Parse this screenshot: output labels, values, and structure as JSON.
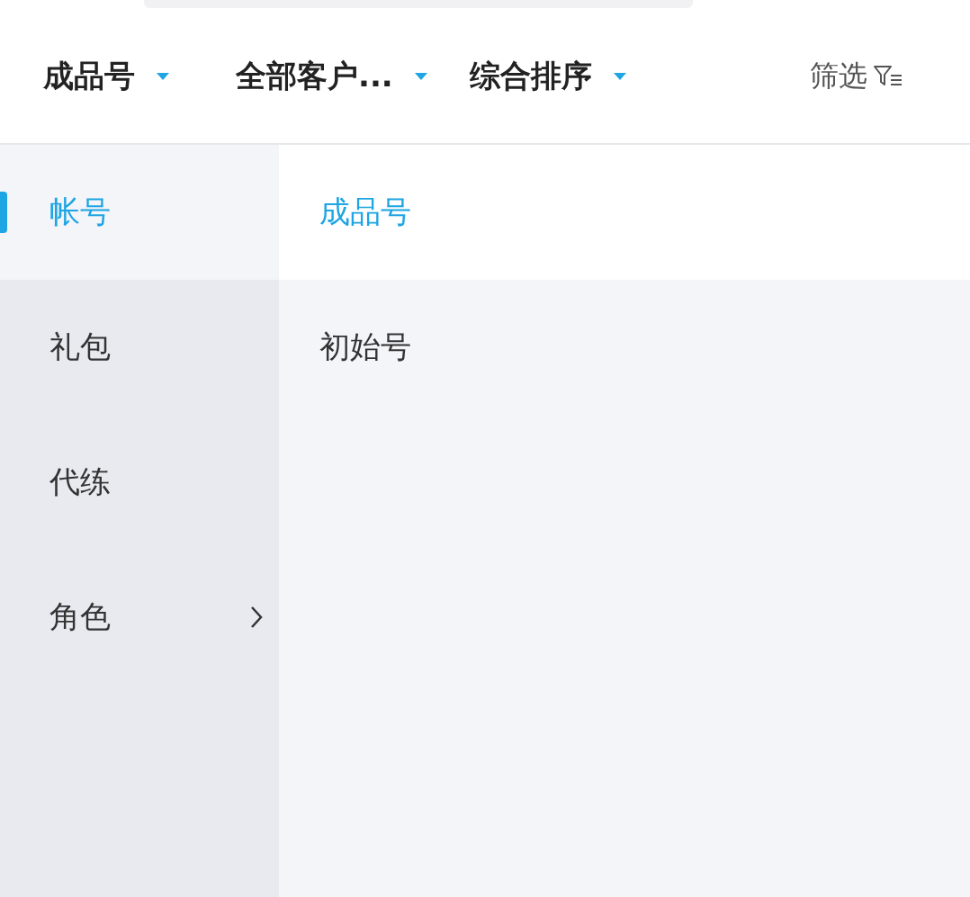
{
  "filter_bar": {
    "dropdowns": [
      {
        "label": "成品号"
      },
      {
        "label": "全部客户..."
      },
      {
        "label": "综合排序"
      }
    ],
    "filter": {
      "label": "筛选"
    }
  },
  "categories": [
    {
      "label": "帐号",
      "selected": true,
      "has_submenu": false
    },
    {
      "label": "礼包",
      "selected": false,
      "has_submenu": false
    },
    {
      "label": "代练",
      "selected": false,
      "has_submenu": false
    },
    {
      "label": "角色",
      "selected": false,
      "has_submenu": true
    }
  ],
  "options": [
    {
      "label": "成品号",
      "selected": true
    },
    {
      "label": "初始号",
      "selected": false
    }
  ]
}
